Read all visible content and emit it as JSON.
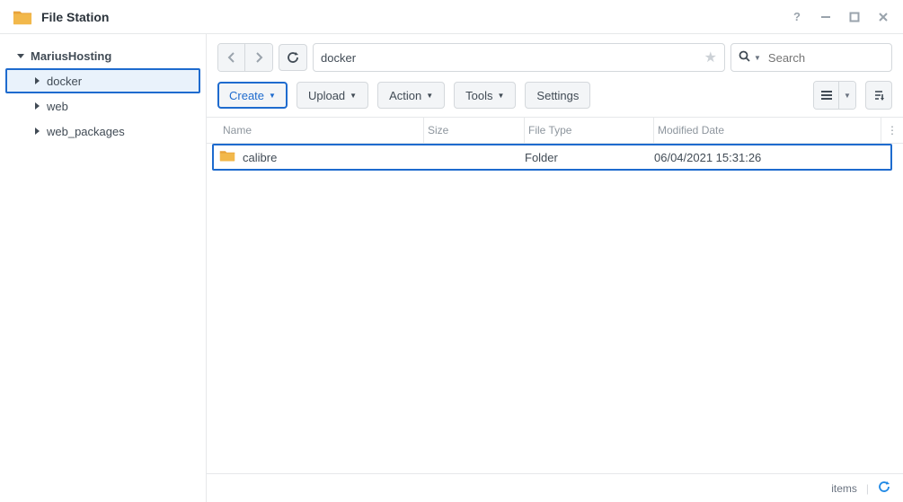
{
  "app": {
    "title": "File Station"
  },
  "sidebar": {
    "root": "MariusHosting",
    "items": [
      {
        "label": "docker",
        "selected": true
      },
      {
        "label": "web",
        "selected": false
      },
      {
        "label": "web_packages",
        "selected": false
      }
    ]
  },
  "pathbar": {
    "path": "docker"
  },
  "search": {
    "placeholder": "Search"
  },
  "toolbar": {
    "create": "Create",
    "upload": "Upload",
    "action": "Action",
    "tools": "Tools",
    "settings": "Settings"
  },
  "columns": {
    "name": "Name",
    "size": "Size",
    "type": "File Type",
    "modified": "Modified Date"
  },
  "rows": [
    {
      "name": "calibre",
      "size": "",
      "type": "Folder",
      "modified": "06/04/2021 15:31:26",
      "selected": true
    }
  ],
  "status": {
    "items_label": "items"
  }
}
